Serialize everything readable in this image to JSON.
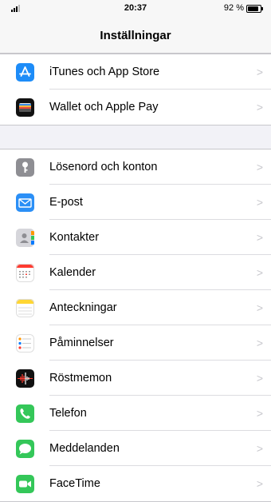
{
  "status_bar": {
    "time": "20:37",
    "battery": "92 %",
    "battery_level": 0.92
  },
  "nav": {
    "title": "Inställningar"
  },
  "groups": [
    {
      "items": [
        {
          "label": "iTunes och App Store",
          "icon": "app-store-icon",
          "color": "#1d8cf8"
        },
        {
          "label": "Wallet och Apple Pay",
          "icon": "wallet-icon",
          "color": "#111111"
        }
      ]
    },
    {
      "items": [
        {
          "label": "Lösenord och konton",
          "icon": "key-icon",
          "color": "#8e8e93"
        },
        {
          "label": "E-post",
          "icon": "mail-icon",
          "color": "#2b8ff6"
        },
        {
          "label": "Kontakter",
          "icon": "contacts-icon",
          "color": "#b9b9be"
        },
        {
          "label": "Kalender",
          "icon": "calendar-icon",
          "color": "#ffffff"
        },
        {
          "label": "Anteckningar",
          "icon": "notes-icon",
          "color": "#ffd633"
        },
        {
          "label": "Påminnelser",
          "icon": "reminders-icon",
          "color": "#ffffff"
        },
        {
          "label": "Röstmemon",
          "icon": "voice-memos-icon",
          "color": "#111111"
        },
        {
          "label": "Telefon",
          "icon": "phone-icon",
          "color": "#34c759"
        },
        {
          "label": "Meddelanden",
          "icon": "messages-icon",
          "color": "#34c759"
        },
        {
          "label": "FaceTime",
          "icon": "facetime-icon",
          "color": "#34c759"
        }
      ]
    }
  ],
  "chevron": ">"
}
